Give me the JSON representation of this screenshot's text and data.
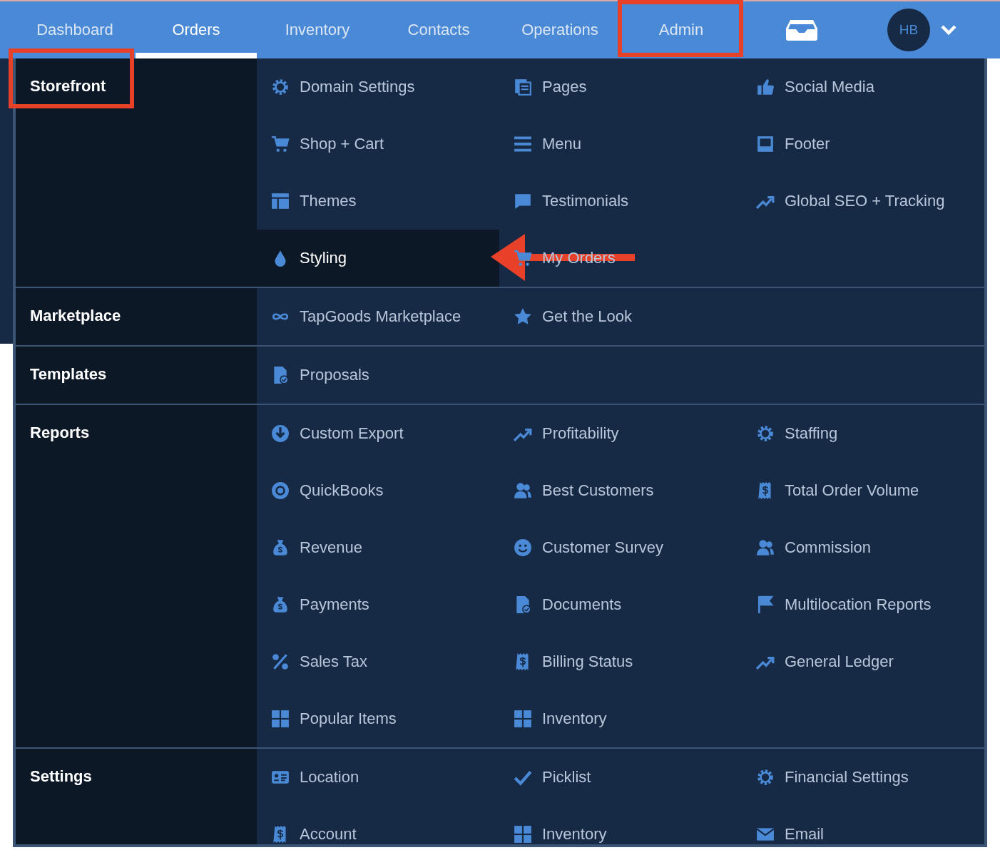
{
  "nav": {
    "tabs": [
      {
        "label": "Dashboard",
        "selected": false,
        "annotated": false
      },
      {
        "label": "Orders",
        "selected": true,
        "annotated": false
      },
      {
        "label": "Inventory",
        "selected": false,
        "annotated": false
      },
      {
        "label": "Contacts",
        "selected": false,
        "annotated": false
      },
      {
        "label": "Operations",
        "selected": false,
        "annotated": false
      },
      {
        "label": "Admin",
        "selected": false,
        "annotated": true
      }
    ],
    "avatar": "HB"
  },
  "menu": {
    "sections": [
      {
        "label": "Storefront",
        "annotated": true,
        "items": [
          {
            "label": "Domain Settings",
            "selected": false,
            "annotated": false
          },
          {
            "label": "Pages",
            "selected": false,
            "annotated": false
          },
          {
            "label": "Social Media",
            "selected": false,
            "annotated": false
          },
          {
            "label": "Shop + Cart",
            "selected": false,
            "annotated": false
          },
          {
            "label": "Menu",
            "selected": false,
            "annotated": false
          },
          {
            "label": "Footer",
            "selected": false,
            "annotated": false
          },
          {
            "label": "Themes",
            "selected": false,
            "annotated": false
          },
          {
            "label": "Testimonials",
            "selected": false,
            "annotated": false
          },
          {
            "label": "Global SEO + Tracking",
            "selected": false,
            "annotated": false
          },
          {
            "label": "Styling",
            "selected": true,
            "annotated": true
          },
          {
            "label": "My Orders",
            "selected": false,
            "annotated": false
          }
        ]
      },
      {
        "label": "Marketplace",
        "annotated": false,
        "items": [
          {
            "label": "TapGoods Marketplace",
            "selected": false,
            "annotated": false
          },
          {
            "label": "Get the Look",
            "selected": false,
            "annotated": false
          }
        ]
      },
      {
        "label": "Templates",
        "annotated": false,
        "items": [
          {
            "label": "Proposals",
            "selected": false,
            "annotated": false
          }
        ]
      },
      {
        "label": "Reports",
        "annotated": false,
        "items": [
          {
            "label": "Custom Export",
            "selected": false,
            "annotated": false
          },
          {
            "label": "Profitability",
            "selected": false,
            "annotated": false
          },
          {
            "label": "Staffing",
            "selected": false,
            "annotated": false
          },
          {
            "label": "QuickBooks",
            "selected": false,
            "annotated": false
          },
          {
            "label": "Best Customers",
            "selected": false,
            "annotated": false
          },
          {
            "label": "Total Order Volume",
            "selected": false,
            "annotated": false
          },
          {
            "label": "Revenue",
            "selected": false,
            "annotated": false
          },
          {
            "label": "Customer Survey",
            "selected": false,
            "annotated": false
          },
          {
            "label": "Commission",
            "selected": false,
            "annotated": false
          },
          {
            "label": "Payments",
            "selected": false,
            "annotated": false
          },
          {
            "label": "Documents",
            "selected": false,
            "annotated": false
          },
          {
            "label": "Multilocation Reports",
            "selected": false,
            "annotated": false
          },
          {
            "label": "Sales Tax",
            "selected": false,
            "annotated": false
          },
          {
            "label": "Billing Status",
            "selected": false,
            "annotated": false
          },
          {
            "label": "General Ledger",
            "selected": false,
            "annotated": false
          },
          {
            "label": "Popular Items",
            "selected": false,
            "annotated": false
          },
          {
            "label": "Inventory",
            "selected": false,
            "annotated": false
          }
        ]
      },
      {
        "label": "Settings",
        "annotated": false,
        "items": [
          {
            "label": "Location",
            "selected": false,
            "annotated": false
          },
          {
            "label": "Picklist",
            "selected": false,
            "annotated": false
          },
          {
            "label": "Financial Settings",
            "selected": false,
            "annotated": false
          },
          {
            "label": "Account",
            "selected": false,
            "annotated": false
          },
          {
            "label": "Inventory",
            "selected": false,
            "annotated": false
          },
          {
            "label": "Email",
            "selected": false,
            "annotated": false
          }
        ]
      }
    ]
  }
}
